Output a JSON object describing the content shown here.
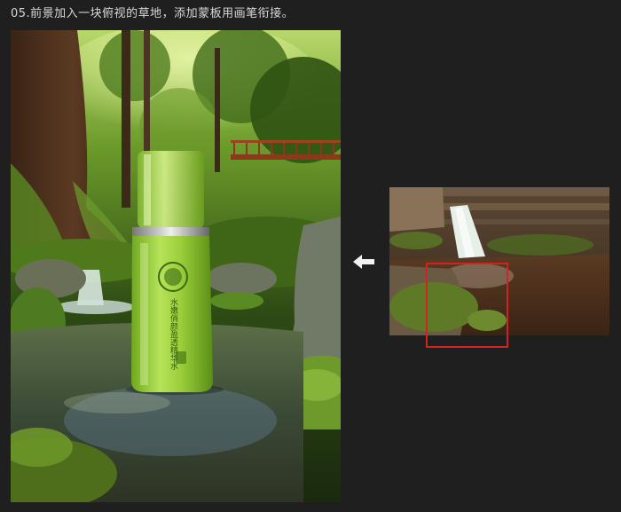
{
  "step": {
    "title": "05.前景加入一块俯视的草地，添加蒙板用画笔衔接。"
  },
  "product": {
    "label_text": "水嫩俏颜盈透精华水"
  },
  "icons": {
    "arrow": "left-arrow-icon"
  },
  "colors": {
    "background": "#1f1f1f",
    "selection": "#d32222",
    "bottle_green": "#9ccf3a"
  }
}
